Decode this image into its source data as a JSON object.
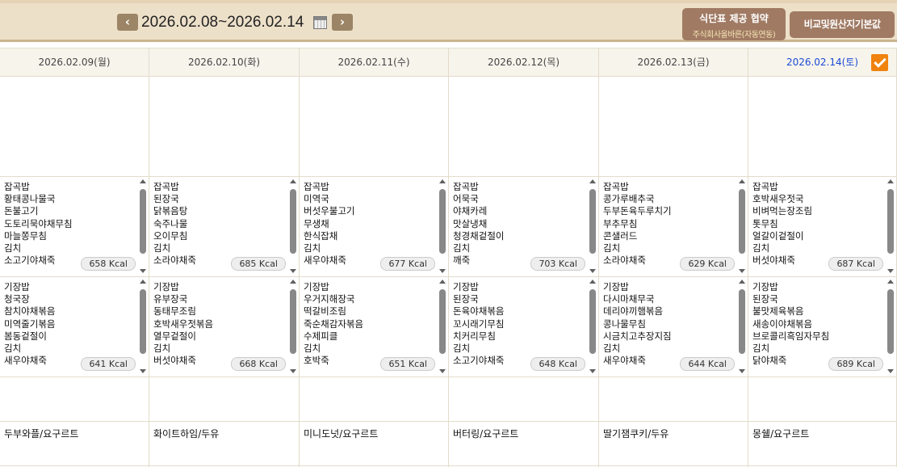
{
  "header": {
    "date_range": "2026.02.08~2026.02.14",
    "prev_label": "‹",
    "next_label": "›",
    "provide_title": "식단표 제공 협약",
    "provide_sub": "주식회사올바른(자동연동)",
    "compare_label": "비교및원산지기본값"
  },
  "days": [
    {
      "label": "2026.02.09(월)",
      "lunch": {
        "items": [
          "잡곡밥",
          "황태콩나물국",
          "돈불고기",
          "도토리묵야채무침",
          "마늘쫑무침",
          "김치",
          "소고기야채죽"
        ],
        "kcal": "658 Kcal"
      },
      "dinner": {
        "items": [
          "기장밥",
          "청국장",
          "참치야채볶음",
          "미역줄기볶음",
          "봄동겉절이",
          "김치",
          "새우야채죽"
        ],
        "kcal": "641 Kcal"
      },
      "snack": "두부와플/요구르트"
    },
    {
      "label": "2026.02.10(화)",
      "lunch": {
        "items": [
          "잡곡밥",
          "된장국",
          "닭볶음탕",
          "숙주나물",
          "오이무침",
          "김치",
          "소라야채죽"
        ],
        "kcal": "685 Kcal"
      },
      "dinner": {
        "items": [
          "기장밥",
          "유부장국",
          "동태무조림",
          "호박새우젓볶음",
          "열무겉절이",
          "김치",
          "버섯야채죽"
        ],
        "kcal": "668 Kcal"
      },
      "snack": "화이트하임/두유"
    },
    {
      "label": "2026.02.11(수)",
      "lunch": {
        "items": [
          "잡곡밥",
          "미역국",
          "버섯우불고기",
          "무생채",
          "한식잡채",
          "김치",
          "새우야채죽"
        ],
        "kcal": "677 Kcal"
      },
      "dinner": {
        "items": [
          "기장밥",
          "우거지해장국",
          "떡갈비조림",
          "죽순채감자볶음",
          "수제피클",
          "김치",
          "호박죽"
        ],
        "kcal": "651 Kcal"
      },
      "snack": "미니도넛/요구르트"
    },
    {
      "label": "2026.02.12(목)",
      "lunch": {
        "items": [
          "잡곡밥",
          "어묵국",
          "야채카레",
          "맛살냉채",
          "청경채겉절이",
          "김치",
          "깨죽"
        ],
        "kcal": "703 Kcal"
      },
      "dinner": {
        "items": [
          "기장밥",
          "된장국",
          "돈육야채볶음",
          "꼬시래기무침",
          "치커리무침",
          "김치",
          "소고기야채죽"
        ],
        "kcal": "648 Kcal"
      },
      "snack": "버터링/요구르트"
    },
    {
      "label": "2026.02.13(금)",
      "lunch": {
        "items": [
          "잡곡밥",
          "콩가루배추국",
          "두부돈육두루치기",
          "부추무침",
          "콘샐러드",
          "김치",
          "소라야채죽"
        ],
        "kcal": "629 Kcal"
      },
      "dinner": {
        "items": [
          "기장밥",
          "다시마채무국",
          "데리야끼햄볶음",
          "콩나물무침",
          "시금치고추장지짐",
          "김치",
          "새우야채죽"
        ],
        "kcal": "644 Kcal"
      },
      "snack": "딸기잼쿠키/두유"
    },
    {
      "label": "2026.02.14(토)",
      "lunch": {
        "items": [
          "잡곡밥",
          "호박새우젓국",
          "비벼먹는장조림",
          "톳무침",
          "얼갈이겉절이",
          "김치",
          "버섯야채죽"
        ],
        "kcal": "687 Kcal"
      },
      "dinner": {
        "items": [
          "기장밥",
          "된장국",
          "불맛제육볶음",
          "새송이야채볶음",
          "브로콜리흑임자무침",
          "김치",
          "닭야채죽"
        ],
        "kcal": "689 Kcal"
      },
      "snack": "몽쉘/요구르트"
    }
  ]
}
